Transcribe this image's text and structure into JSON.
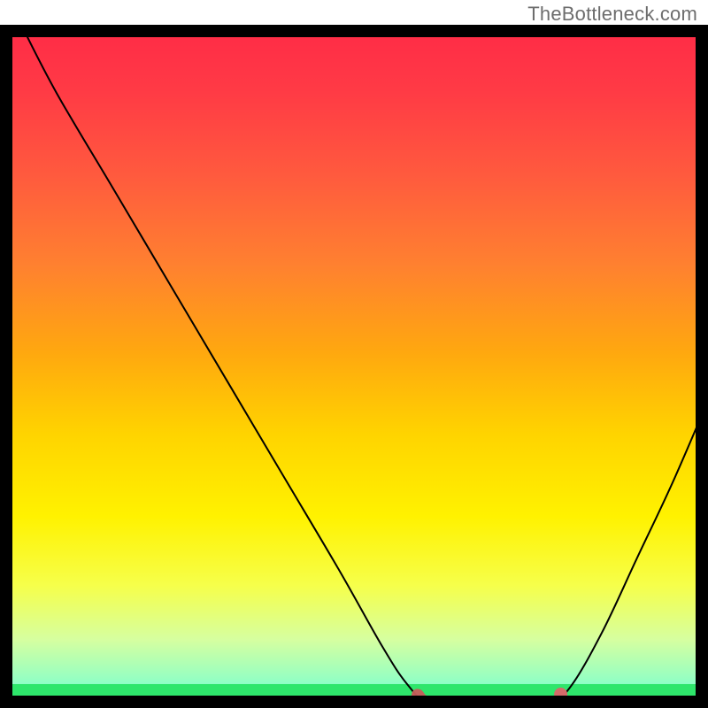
{
  "watermark": "TheBottleneck.com",
  "colors": {
    "frame": "#000000",
    "curve": "#000000",
    "good_band": "#2ee66b",
    "marker_fill": "#d46a6a",
    "marker_stroke": "#c95c5c"
  },
  "layout": {
    "plot_top_pad": 28,
    "frame_stroke": 14
  },
  "chart_data": {
    "type": "line",
    "title": "",
    "xlabel": "",
    "ylabel": "",
    "xlim": [
      0,
      100
    ],
    "ylim": [
      0,
      100
    ],
    "gradient_stops": [
      {
        "offset": 0.0,
        "color": "#ff2a47"
      },
      {
        "offset": 0.1,
        "color": "#ff3b45"
      },
      {
        "offset": 0.22,
        "color": "#ff5a3e"
      },
      {
        "offset": 0.35,
        "color": "#ff8030"
      },
      {
        "offset": 0.48,
        "color": "#ffa80f"
      },
      {
        "offset": 0.6,
        "color": "#ffd400"
      },
      {
        "offset": 0.72,
        "color": "#fff200"
      },
      {
        "offset": 0.82,
        "color": "#f6ff4a"
      },
      {
        "offset": 0.9,
        "color": "#d6ffa0"
      },
      {
        "offset": 0.965,
        "color": "#8effc6"
      },
      {
        "offset": 1.0,
        "color": "#1fe06a"
      }
    ],
    "curve_points": [
      {
        "x": 3.0,
        "y": 100.0
      },
      {
        "x": 8.0,
        "y": 90.0
      },
      {
        "x": 16.0,
        "y": 76.0
      },
      {
        "x": 24.0,
        "y": 62.0
      },
      {
        "x": 32.0,
        "y": 48.0
      },
      {
        "x": 40.0,
        "y": 34.0
      },
      {
        "x": 48.0,
        "y": 20.0
      },
      {
        "x": 54.0,
        "y": 9.0
      },
      {
        "x": 57.5,
        "y": 3.5
      },
      {
        "x": 60.5,
        "y": 0.8
      },
      {
        "x": 66.0,
        "y": 0.5
      },
      {
        "x": 72.0,
        "y": 0.5
      },
      {
        "x": 77.5,
        "y": 0.8
      },
      {
        "x": 80.5,
        "y": 3.0
      },
      {
        "x": 85.0,
        "y": 11.0
      },
      {
        "x": 90.0,
        "y": 22.0
      },
      {
        "x": 95.0,
        "y": 33.0
      },
      {
        "x": 100.0,
        "y": 45.0
      }
    ],
    "marker_segment": [
      {
        "x": 59.0,
        "y": 1.9
      },
      {
        "x": 60.5,
        "y": 0.8
      },
      {
        "x": 66.0,
        "y": 0.5
      },
      {
        "x": 72.0,
        "y": 0.5
      },
      {
        "x": 76.5,
        "y": 0.7
      }
    ],
    "marker_dot": {
      "x": 79.2,
      "y": 2.0
    },
    "good_band": {
      "from_y": 0,
      "to_y": 3.5
    }
  }
}
